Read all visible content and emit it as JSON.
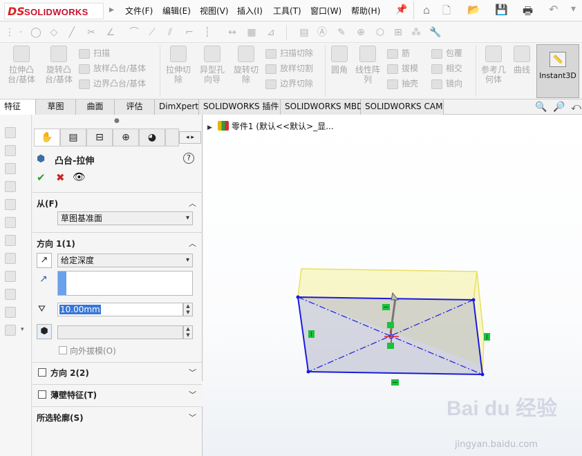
{
  "app": {
    "logo_text": "SOLIDWORKS",
    "logo_mark": "DS"
  },
  "menu": [
    {
      "label": "文件(F)"
    },
    {
      "label": "编辑(E)"
    },
    {
      "label": "视图(V)"
    },
    {
      "label": "插入(I)"
    },
    {
      "label": "工具(T)"
    },
    {
      "label": "窗口(W)"
    },
    {
      "label": "帮助(H)"
    }
  ],
  "command_manager": {
    "extrude_boss": "拉伸凸台/基体",
    "revolve_boss": "旋转凸台/基体",
    "sweep": "扫描",
    "loft": "放样凸台/基体",
    "boundary": "边界凸台/基体",
    "extrude_cut": "拉伸切除",
    "hole_wizard": "异型孔向导",
    "revolve_cut": "旋转切除",
    "swept_cut": "扫描切除",
    "lofted_cut": "放样切割",
    "boundary_cut": "边界切除",
    "fillet": "圆角",
    "linear_pattern": "线性阵列",
    "rib": "筋",
    "draft": "拔模",
    "shell": "抽壳",
    "wrap": "包覆",
    "intersect": "相交",
    "mirror": "镜向",
    "ref_geometry": "参考几何体",
    "curves": "曲线",
    "instant3d": "Instant3D"
  },
  "tabs": [
    "特征",
    "草图",
    "曲面",
    "评估",
    "DimXpert",
    "SOLIDWORKS 插件",
    "SOLIDWORKS MBD",
    "SOLIDWORKS CAM"
  ],
  "tree": {
    "root_label": "零件1  (默认<<默认>_显..."
  },
  "property_manager": {
    "title": "凸台-拉伸",
    "from": {
      "label": "从(F)",
      "value": "草图基准面"
    },
    "direction1": {
      "label": "方向 1(1)",
      "end_condition": "给定深度",
      "depth_value": "10.00mm",
      "draft_outward_label": "向外拔模(O)"
    },
    "direction2": {
      "label": "方向 2(2)"
    },
    "thin_feature": {
      "label": "薄壁特征(T)"
    },
    "selected_contours": {
      "label": "所选轮廓(S)"
    }
  },
  "watermark": {
    "logo": "Bai du 经验",
    "url": "jingyan.baidu.com"
  },
  "colors": {
    "accent_red": "#c8102e",
    "sketch_blue": "#1a1adc",
    "preview_yellow": "#f5f08a",
    "handle_green": "#19c23a"
  }
}
